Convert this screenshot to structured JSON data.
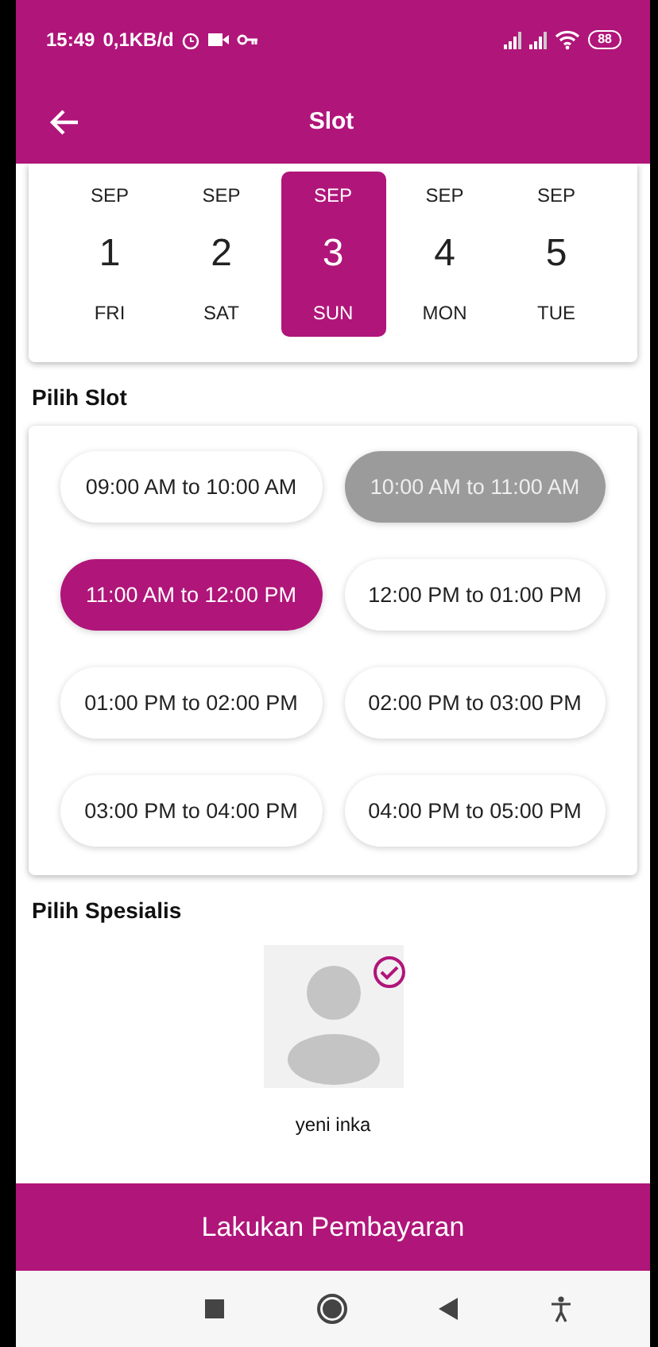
{
  "status_bar": {
    "time": "15:49",
    "speed": "0,1KB/d",
    "battery": "88"
  },
  "app_bar": {
    "title": "Slot"
  },
  "dates": [
    {
      "month": "SEP",
      "day": "1",
      "weekday": "FRI",
      "selected": false
    },
    {
      "month": "SEP",
      "day": "2",
      "weekday": "SAT",
      "selected": false
    },
    {
      "month": "SEP",
      "day": "3",
      "weekday": "SUN",
      "selected": true
    },
    {
      "month": "SEP",
      "day": "4",
      "weekday": "MON",
      "selected": false
    },
    {
      "month": "SEP",
      "day": "5",
      "weekday": "TUE",
      "selected": false
    }
  ],
  "slot_heading": "Pilih Slot",
  "slots": [
    {
      "label": "09:00 AM to 10:00 AM",
      "selected": false,
      "disabled": false
    },
    {
      "label": "10:00 AM to 11:00 AM",
      "selected": false,
      "disabled": true
    },
    {
      "label": "11:00 AM to 12:00 PM",
      "selected": true,
      "disabled": false
    },
    {
      "label": "12:00 PM to 01:00 PM",
      "selected": false,
      "disabled": false
    },
    {
      "label": "01:00 PM to 02:00 PM",
      "selected": false,
      "disabled": false
    },
    {
      "label": "02:00 PM to 03:00 PM",
      "selected": false,
      "disabled": false
    },
    {
      "label": "03:00 PM to 04:00 PM",
      "selected": false,
      "disabled": false
    },
    {
      "label": "04:00 PM to 05:00 PM",
      "selected": false,
      "disabled": false
    }
  ],
  "specialist_heading": "Pilih Spesialis",
  "specialists": [
    {
      "name": "yeni inka",
      "selected": true
    }
  ],
  "pay_button": "Lakukan Pembayaran"
}
